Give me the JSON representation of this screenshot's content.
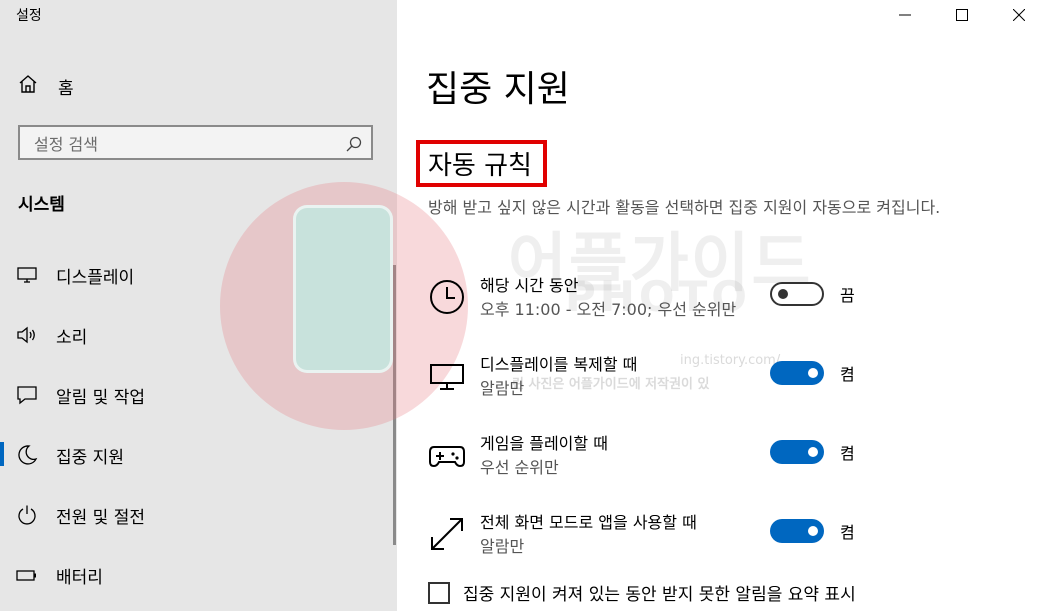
{
  "window": {
    "title": "설정"
  },
  "sidebar": {
    "home_label": "홈",
    "search_placeholder": "설정 검색",
    "section_title": "시스템",
    "items": [
      {
        "label": "디스플레이",
        "icon": "monitor-icon"
      },
      {
        "label": "소리",
        "icon": "speaker-icon"
      },
      {
        "label": "알림 및 작업",
        "icon": "notification-icon"
      },
      {
        "label": "집중 지원",
        "icon": "moon-icon",
        "active": true
      },
      {
        "label": "전원 및 절전",
        "icon": "power-icon"
      },
      {
        "label": "배터리",
        "icon": "battery-icon"
      }
    ]
  },
  "main": {
    "title": "집중 지원",
    "subtitle": "자동 규칙",
    "description": "방해 받고 싶지 않은 시간과 활동을 선택하면 집중 지원이 자동으로 켜집니다.",
    "rules": [
      {
        "title": "해당 시간 동안",
        "sub": "오후 11:00 - 오전 7:00; 우선 순위만",
        "toggle": "끔",
        "on": false,
        "icon": "clock-icon"
      },
      {
        "title": "디스플레이를 복제할 때",
        "sub": "알람만",
        "toggle": "켬",
        "on": true,
        "icon": "monitor-icon"
      },
      {
        "title": "게임을 플레이할 때",
        "sub": "우선 순위만",
        "toggle": "켬",
        "on": true,
        "icon": "gamepad-icon"
      },
      {
        "title": "전체 화면 모드로 앱을 사용할 때",
        "sub": "알람만",
        "toggle": "켬",
        "on": true,
        "icon": "fullscreen-icon"
      }
    ],
    "checkbox_label": "집중 지원이 켜져 있는 동안 받지 못한 알림을 요약 표시"
  },
  "watermark": {
    "brand": "어플가이드",
    "photo": "PHOTO",
    "url": "ing.tistory.com/",
    "copyright": "린 사진은 어플가이드에 저작권이 있"
  },
  "colors": {
    "accent": "#0067c0",
    "sidebar_bg": "#e6e6e6",
    "highlight": "#e00000"
  }
}
